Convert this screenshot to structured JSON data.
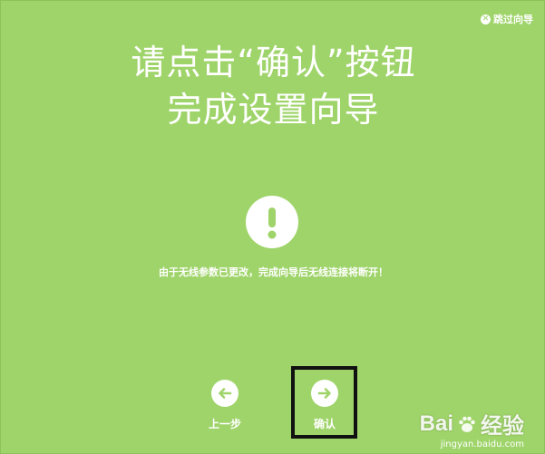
{
  "skip_wizard": {
    "label": "跳过向导",
    "icon": "close-circle-icon"
  },
  "title": {
    "line1": "请点击“确认”按钮",
    "line2": "完成设置向导"
  },
  "warning": {
    "icon": "exclamation-icon",
    "message": "由于无线参数已更改，完成向导后无线连接将断开！"
  },
  "nav": {
    "prev_label": "上一步",
    "prev_icon": "arrow-left-icon",
    "confirm_label": "确认",
    "confirm_icon": "arrow-right-icon"
  },
  "watermark": {
    "brand": "Bai",
    "brand2": "经验",
    "url": "jingyan.baidu.com"
  },
  "colors": {
    "background": "#9fd46a",
    "foreground": "#ffffff",
    "highlight_border": "#111111"
  }
}
